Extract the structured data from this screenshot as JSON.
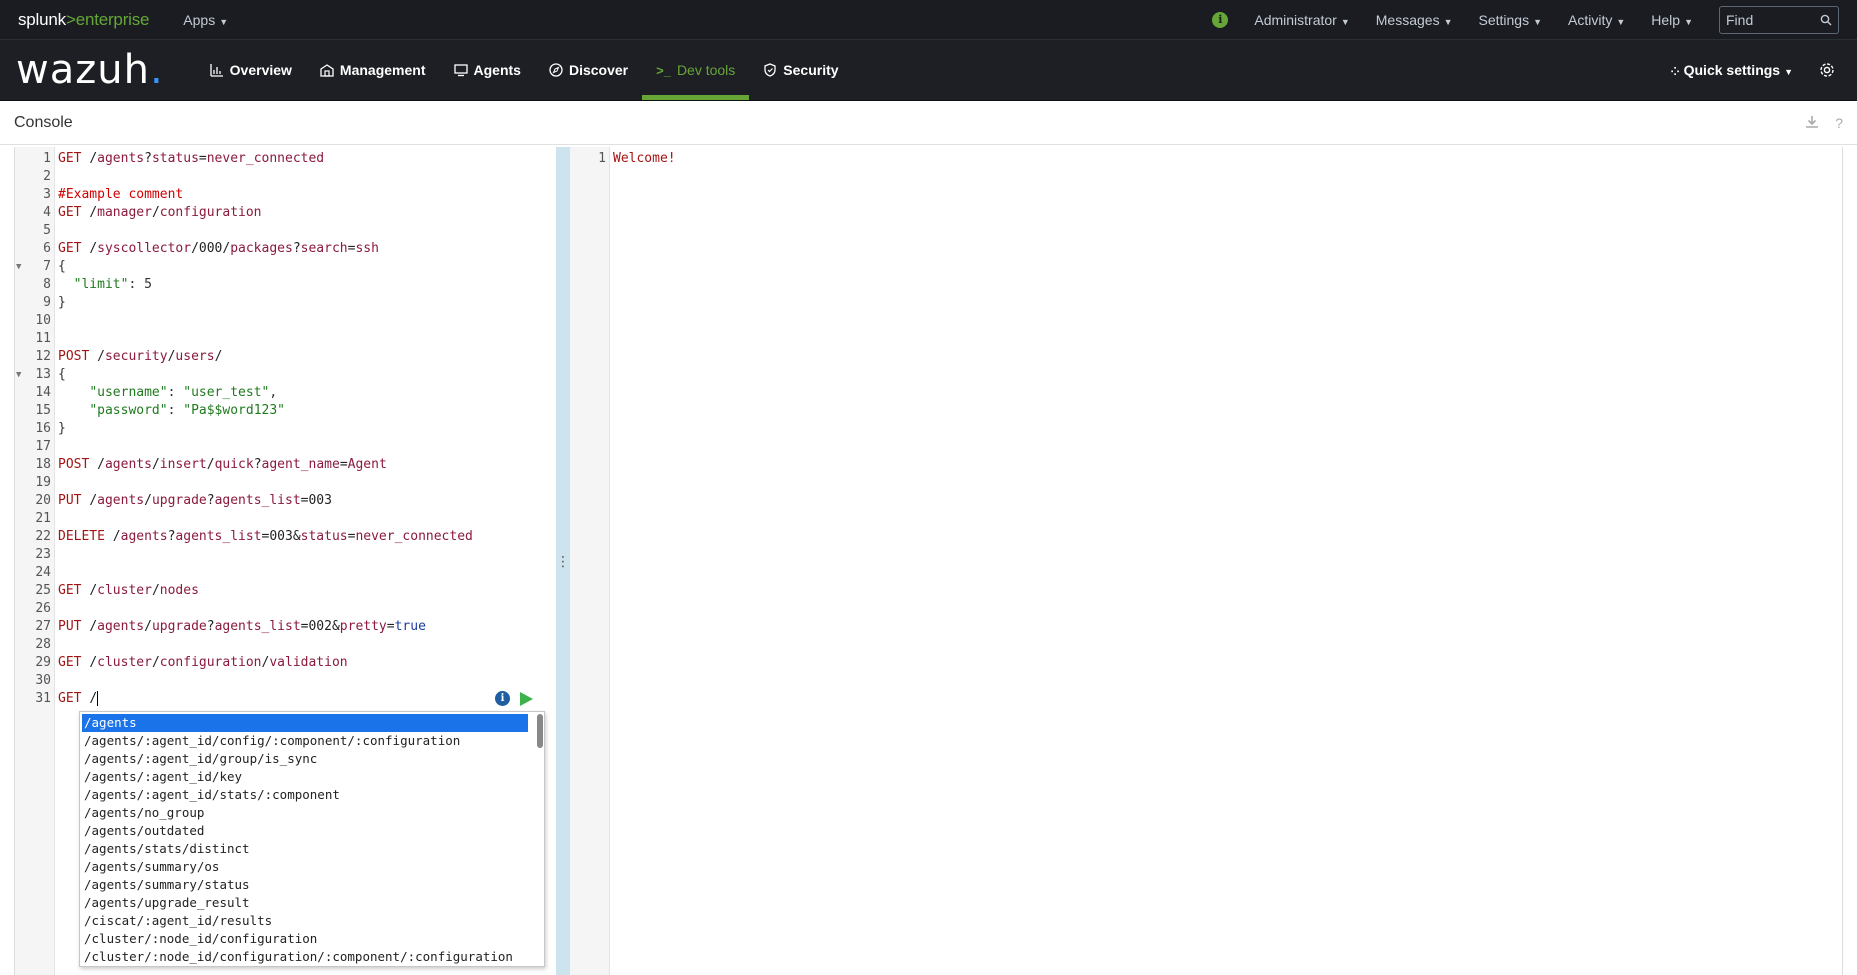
{
  "splunk": {
    "logo_brand": "splunk",
    "logo_sep": ">",
    "logo_product": "enterprise",
    "apps": "Apps",
    "user": "Administrator",
    "messages": "Messages",
    "settings": "Settings",
    "activity": "Activity",
    "help": "Help",
    "find_placeholder": "Find"
  },
  "wazuh": {
    "logo": "wazuh",
    "logo_dot": ".",
    "nav": [
      {
        "label": "Overview",
        "icon": "overview-icon"
      },
      {
        "label": "Management",
        "icon": "management-icon"
      },
      {
        "label": "Agents",
        "icon": "agents-icon"
      },
      {
        "label": "Discover",
        "icon": "compass-icon"
      },
      {
        "label": "Dev tools",
        "icon": "terminal-icon"
      },
      {
        "label": "Security",
        "icon": "shield-icon"
      }
    ],
    "active": "Dev tools",
    "quick_settings": "Quick settings",
    "accent": "#65a637"
  },
  "console": {
    "title": "Console",
    "response_lines": [
      "Welcome!"
    ]
  },
  "editor": {
    "lines": [
      "GET /agents?status=never_connected",
      "",
      "#Example comment",
      "GET /manager/configuration",
      "",
      "GET /syscollector/000/packages?search=ssh",
      "{",
      "  \"limit\": 5",
      "}",
      "",
      "",
      "POST /security/users/",
      "{",
      "    \"username\": \"user_test\",",
      "    \"password\": \"Pa$$word123\"",
      "}",
      "",
      "POST /agents/insert/quick?agent_name=Agent",
      "",
      "PUT /agents/upgrade?agents_list=003",
      "",
      "DELETE /agents?agents_list=003&status=never_connected",
      "",
      "",
      "GET /cluster/nodes",
      "",
      "PUT /agents/upgrade?agents_list=002&pretty=true",
      "",
      "GET /cluster/configuration/validation",
      "",
      "GET /"
    ]
  },
  "autocomplete": {
    "items": [
      "/agents",
      "/agents/:agent_id/config/:component/:configuration",
      "/agents/:agent_id/group/is_sync",
      "/agents/:agent_id/key",
      "/agents/:agent_id/stats/:component",
      "/agents/no_group",
      "/agents/outdated",
      "/agents/stats/distinct",
      "/agents/summary/os",
      "/agents/summary/status",
      "/agents/upgrade_result",
      "/ciscat/:agent_id/results",
      "/cluster/:node_id/configuration",
      "/cluster/:node_id/configuration/:component/:configuration"
    ],
    "selected": 0
  }
}
